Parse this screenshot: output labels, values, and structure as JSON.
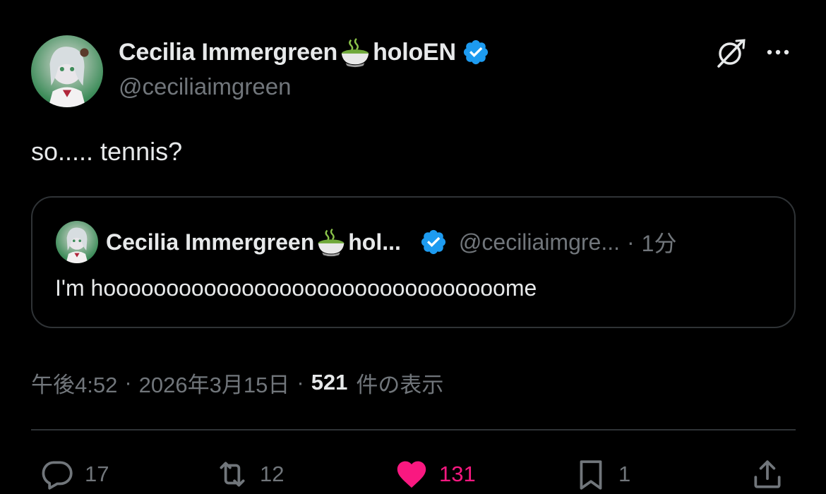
{
  "author": {
    "display_name_part1": "Cecilia Immergreen",
    "display_name_part2": "holoEN",
    "handle": "@ceciliaimgreen"
  },
  "tweet": {
    "text": "so..... tennis?"
  },
  "quote": {
    "name_part1": "Cecilia Immergreen",
    "name_part2": "hol...",
    "handle": "@ceciliaimgre...",
    "separator": "·",
    "time": "1分",
    "text": "I'm hoooooooooooooooooooooooooooooooome"
  },
  "meta": {
    "time": "午後4:52",
    "separator": "·",
    "date": "2026年3月15日",
    "views_count": "521",
    "views_label": "件の表示"
  },
  "actions": {
    "reply_count": "17",
    "repost_count": "12",
    "like_count": "131",
    "bookmark_count": "1"
  },
  "colors": {
    "background": "#000000",
    "text_primary": "#e7e9ea",
    "text_secondary": "#71767b",
    "verified_blue": "#1d9bf0",
    "like_pink": "#f91880",
    "border": "#2f3336"
  },
  "icons": {
    "grok": "grok-icon",
    "more": "more-icon",
    "verified": "verified-badge-icon",
    "tea": "matcha-tea-emoji-icon",
    "reply": "reply-icon",
    "repost": "repost-icon",
    "like": "heart-icon",
    "bookmark": "bookmark-icon",
    "share": "share-icon"
  }
}
